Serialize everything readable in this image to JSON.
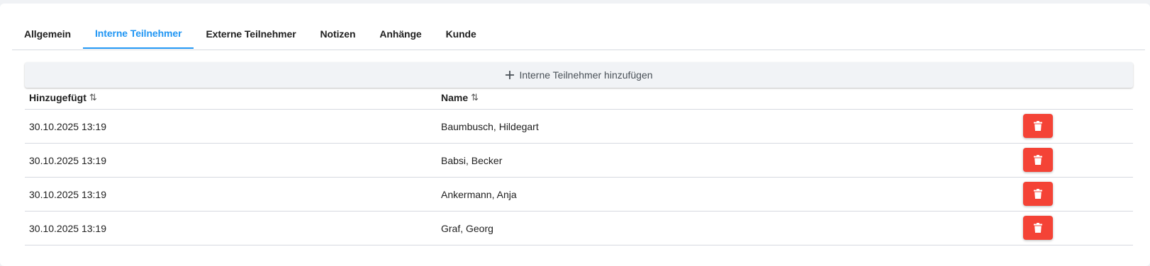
{
  "tabs": [
    {
      "label": "Allgemein",
      "active": false
    },
    {
      "label": "Interne Teilnehmer",
      "active": true
    },
    {
      "label": "Externe Teilnehmer",
      "active": false
    },
    {
      "label": "Notizen",
      "active": false
    },
    {
      "label": "Anhänge",
      "active": false
    },
    {
      "label": "Kunde",
      "active": false
    }
  ],
  "add_button": {
    "icon": "plus-icon",
    "label": "Interne Teilnehmer hinzufügen"
  },
  "table": {
    "columns": [
      {
        "label": "Hinzugefügt",
        "sort_icon": "⇅"
      },
      {
        "label": "Name",
        "sort_icon": "⇅"
      }
    ],
    "rows": [
      {
        "added": "30.10.2025 13:19",
        "name": "Baumbusch, Hildegart"
      },
      {
        "added": "30.10.2025 13:19",
        "name": "Babsi, Becker"
      },
      {
        "added": "30.10.2025 13:19",
        "name": "Ankermann, Anja"
      },
      {
        "added": "30.10.2025 13:19",
        "name": "Graf, Georg"
      }
    ],
    "delete_icon": "trash-icon"
  },
  "colors": {
    "accent": "#2196f3",
    "danger": "#f44336"
  }
}
